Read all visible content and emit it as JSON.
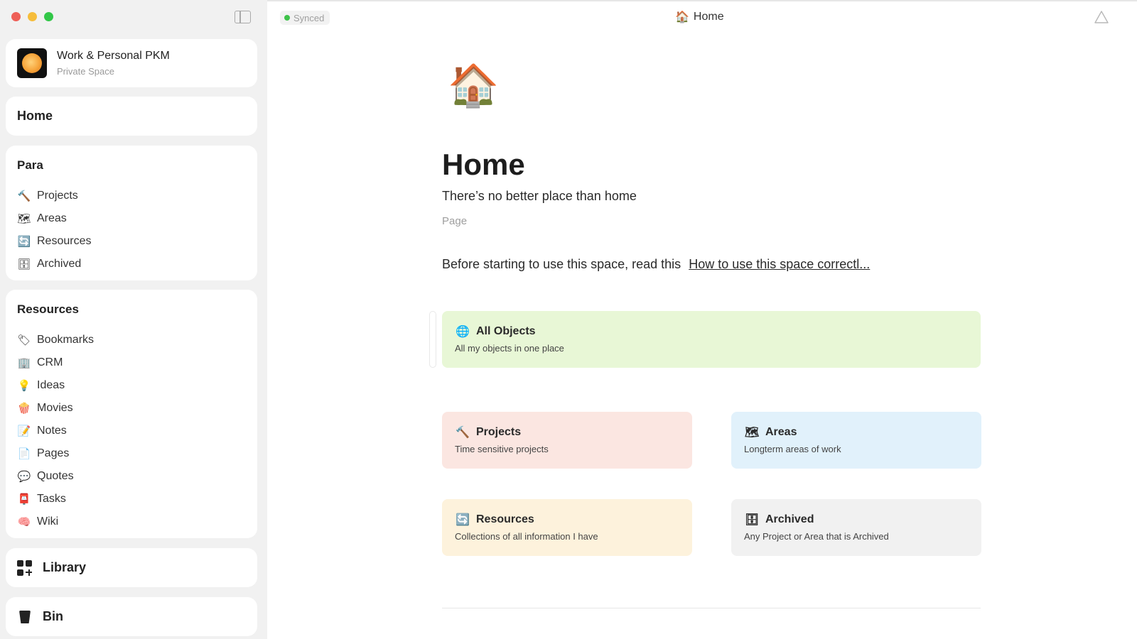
{
  "window": {
    "sync_status": "Synced",
    "tab_title": "Home",
    "tab_icon": "house-emoji"
  },
  "sidebar": {
    "space": {
      "name": "Work & Personal PKM",
      "subtitle": "Private Space"
    },
    "home_label": "Home",
    "para": {
      "title": "Para",
      "items": [
        {
          "label": "Projects",
          "icon": "🔨",
          "icon_name": "hammer-icon"
        },
        {
          "label": "Areas",
          "icon": "🗺",
          "icon_name": "map-icon"
        },
        {
          "label": "Resources",
          "icon": "🔄",
          "icon_name": "refresh-icon"
        },
        {
          "label": "Archived",
          "icon": "🗄",
          "icon_name": "cabinet-icon"
        }
      ]
    },
    "resources": {
      "title": "Resources",
      "items": [
        {
          "label": "Bookmarks",
          "icon": "🏷",
          "icon_name": "tag-icon"
        },
        {
          "label": "CRM",
          "icon": "🏢",
          "icon_name": "building-icon"
        },
        {
          "label": "Ideas",
          "icon": "💡",
          "icon_name": "bulb-icon"
        },
        {
          "label": "Movies",
          "icon": "🍿",
          "icon_name": "popcorn-icon"
        },
        {
          "label": "Notes",
          "icon": "📝",
          "icon_name": "memo-icon"
        },
        {
          "label": "Pages",
          "icon": "📄",
          "icon_name": "page-icon"
        },
        {
          "label": "Quotes",
          "icon": "💬",
          "icon_name": "speech-icon"
        },
        {
          "label": "Tasks",
          "icon": "📮",
          "icon_name": "postbox-icon"
        },
        {
          "label": "Wiki",
          "icon": "🧠",
          "icon_name": "brain-icon"
        }
      ]
    },
    "library_label": "Library",
    "bin_label": "Bin"
  },
  "page": {
    "icon": "🏠",
    "title": "Home",
    "description": "There’s no better place than home",
    "type": "Page",
    "intro_text": "Before starting to use this space, read this",
    "intro_link": "How to use this space correctl..."
  },
  "tiles": {
    "all_objects": {
      "title": "All Objects",
      "subtitle": "All my objects in one place",
      "icon": "🌐",
      "color": "#e8f7d6"
    },
    "projects": {
      "title": "Projects",
      "subtitle": "Time sensitive projects",
      "icon": "🔨",
      "color": "#fbe6e1"
    },
    "areas": {
      "title": "Areas",
      "subtitle": "Longterm areas of work",
      "icon": "🗺",
      "color": "#e1f1fb"
    },
    "resources": {
      "title": "Resources",
      "subtitle": "Collections of all information I have",
      "icon": "🔄",
      "color": "#fdf2dc"
    },
    "archived": {
      "title": "Archived",
      "subtitle": "Any Project or Area that is Archived",
      "icon": "🗄",
      "color": "#f1f1f1"
    }
  }
}
